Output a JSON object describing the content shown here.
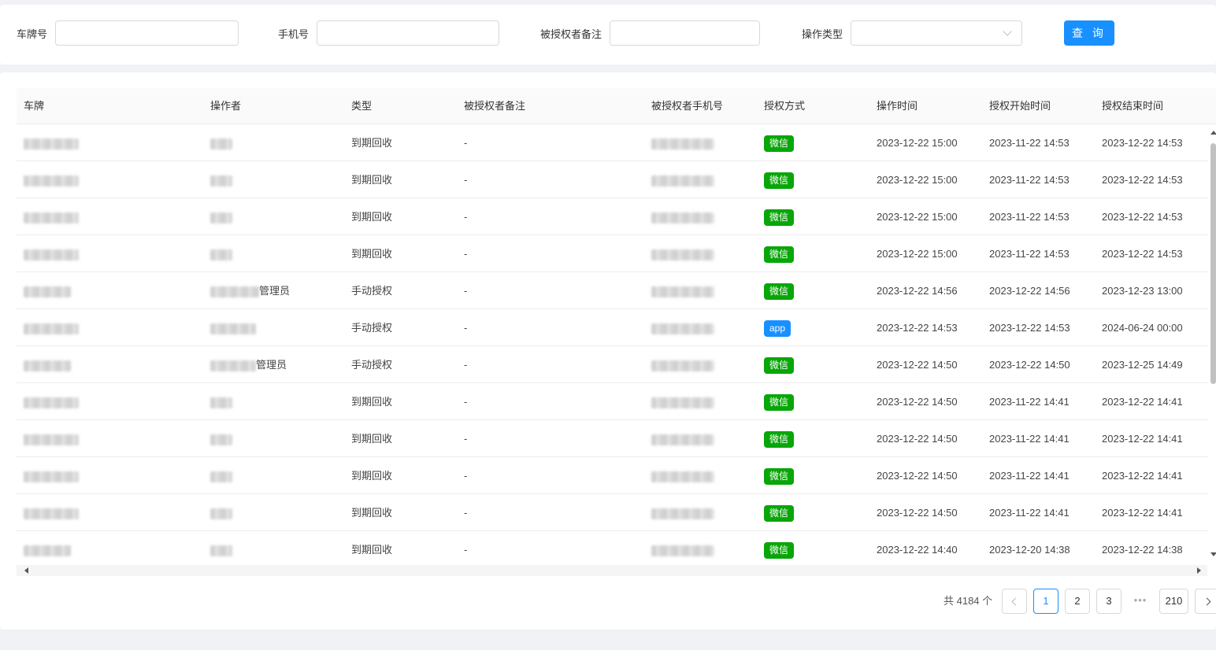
{
  "filters": {
    "plate_label": "车牌号",
    "plate_value": "",
    "phone_label": "手机号",
    "phone_value": "",
    "remark_label": "被授权者备注",
    "remark_value": "",
    "optype_label": "操作类型",
    "optype_value": "",
    "query_label": "查 询"
  },
  "table": {
    "columns": [
      "车牌",
      "操作者",
      "类型",
      "被授权者备注",
      "被授权者手机号",
      "授权方式",
      "操作时间",
      "授权开始时间",
      "授权结束时间"
    ],
    "rows": [
      {
        "plate": "",
        "operator": "",
        "type": "到期回收",
        "remark": "-",
        "phone": "",
        "method": "微信",
        "method_color": "#09a609",
        "op_time": "2023-12-22 15:00",
        "start": "2023-11-22 14:53",
        "end": "2023-12-22 14:53"
      },
      {
        "plate": "",
        "operator": "",
        "type": "到期回收",
        "remark": "-",
        "phone": "",
        "method": "微信",
        "method_color": "#09a609",
        "op_time": "2023-12-22 15:00",
        "start": "2023-11-22 14:53",
        "end": "2023-12-22 14:53"
      },
      {
        "plate": "",
        "operator": "",
        "type": "到期回收",
        "remark": "-",
        "phone": "",
        "method": "微信",
        "method_color": "#09a609",
        "op_time": "2023-12-22 15:00",
        "start": "2023-11-22 14:53",
        "end": "2023-12-22 14:53"
      },
      {
        "plate": "",
        "operator": "",
        "type": "到期回收",
        "remark": "-",
        "phone": "",
        "method": "微信",
        "method_color": "#09a609",
        "op_time": "2023-12-22 15:00",
        "start": "2023-11-22 14:53",
        "end": "2023-12-22 14:53"
      },
      {
        "plate": "",
        "operator": "管理员",
        "type": "手动授权",
        "remark": "-",
        "phone": "",
        "method": "微信",
        "method_color": "#09a609",
        "op_time": "2023-12-22 14:56",
        "start": "2023-12-22 14:56",
        "end": "2023-12-23 13:00"
      },
      {
        "plate": "",
        "operator": "",
        "type": "手动授权",
        "remark": "-",
        "phone": "",
        "method": "app",
        "method_color": "#1890ff",
        "op_time": "2023-12-22 14:53",
        "start": "2023-12-22 14:53",
        "end": "2024-06-24 00:00"
      },
      {
        "plate": "",
        "operator": "管理员",
        "type": "手动授权",
        "remark": "-",
        "phone": "",
        "method": "微信",
        "method_color": "#09a609",
        "op_time": "2023-12-22 14:50",
        "start": "2023-12-22 14:50",
        "end": "2023-12-25 14:49"
      },
      {
        "plate": "",
        "operator": "",
        "type": "到期回收",
        "remark": "-",
        "phone": "",
        "method": "微信",
        "method_color": "#09a609",
        "op_time": "2023-12-22 14:50",
        "start": "2023-11-22 14:41",
        "end": "2023-12-22 14:41"
      },
      {
        "plate": "",
        "operator": "",
        "type": "到期回收",
        "remark": "-",
        "phone": "",
        "method": "微信",
        "method_color": "#09a609",
        "op_time": "2023-12-22 14:50",
        "start": "2023-11-22 14:41",
        "end": "2023-12-22 14:41"
      },
      {
        "plate": "",
        "operator": "",
        "type": "到期回收",
        "remark": "-",
        "phone": "",
        "method": "微信",
        "method_color": "#09a609",
        "op_time": "2023-12-22 14:50",
        "start": "2023-11-22 14:41",
        "end": "2023-12-22 14:41"
      },
      {
        "plate": "",
        "operator": "",
        "type": "到期回收",
        "remark": "-",
        "phone": "",
        "method": "微信",
        "method_color": "#09a609",
        "op_time": "2023-12-22 14:50",
        "start": "2023-11-22 14:41",
        "end": "2023-12-22 14:41"
      },
      {
        "plate": "",
        "operator": "",
        "type": "到期回收",
        "remark": "-",
        "phone": "",
        "method": "微信",
        "method_color": "#09a609",
        "op_time": "2023-12-22 14:40",
        "start": "2023-12-20 14:38",
        "end": "2023-12-22 14:38"
      }
    ]
  },
  "pagination": {
    "total_text": "共 4184 个",
    "pages": [
      "1",
      "2",
      "3",
      "210"
    ],
    "current": "1",
    "ellipsis": "•••"
  }
}
